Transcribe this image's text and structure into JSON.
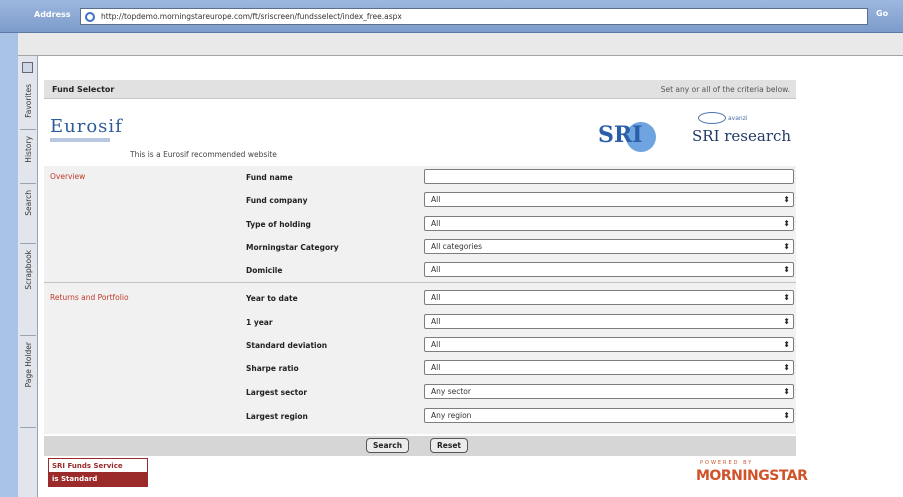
{
  "browser": {
    "address_label": "Address",
    "url": "http://topdemo.morningstareurope.com/ft/sriscreen/fundsselect/index_free.aspx",
    "go_label": "Go"
  },
  "sidebar": {
    "tabs": [
      {
        "label": "Favorites"
      },
      {
        "label": "History"
      },
      {
        "label": "Search"
      },
      {
        "label": "Scrapbook"
      },
      {
        "label": "Page Holder"
      }
    ]
  },
  "panel": {
    "title": "Fund Selector",
    "instruction": "Set any or all of the criteria below.",
    "eurosif_logo": "Eurosif",
    "recommended": "This is a Eurosif recommended website",
    "sri_logo": "SRI",
    "sri_research_small": "avanzi",
    "sri_research": "SRI research"
  },
  "sections": {
    "overview": "Overview",
    "returns": "Returns and Portfolio"
  },
  "fields": [
    {
      "label": "Fund name",
      "value": ""
    },
    {
      "label": "Fund company",
      "value": "All"
    },
    {
      "label": "Type of holding",
      "value": "All"
    },
    {
      "label": "Morningstar Category",
      "value": "All categories"
    },
    {
      "label": "Domicile",
      "value": "All"
    },
    {
      "label": "Year to date",
      "value": "All"
    },
    {
      "label": "1 year",
      "value": "All"
    },
    {
      "label": "Standard deviation",
      "value": "All"
    },
    {
      "label": "Sharpe ratio",
      "value": "All"
    },
    {
      "label": "Largest sector",
      "value": "Any sector"
    },
    {
      "label": "Largest region",
      "value": "Any region"
    }
  ],
  "buttons": {
    "search": "Search",
    "reset": "Reset"
  },
  "footer": {
    "badge_top": "SRI Funds Service",
    "badge_bottom": "is Standard",
    "powered": "POWERED BY",
    "morningstar": "MORNINGSTAR"
  }
}
